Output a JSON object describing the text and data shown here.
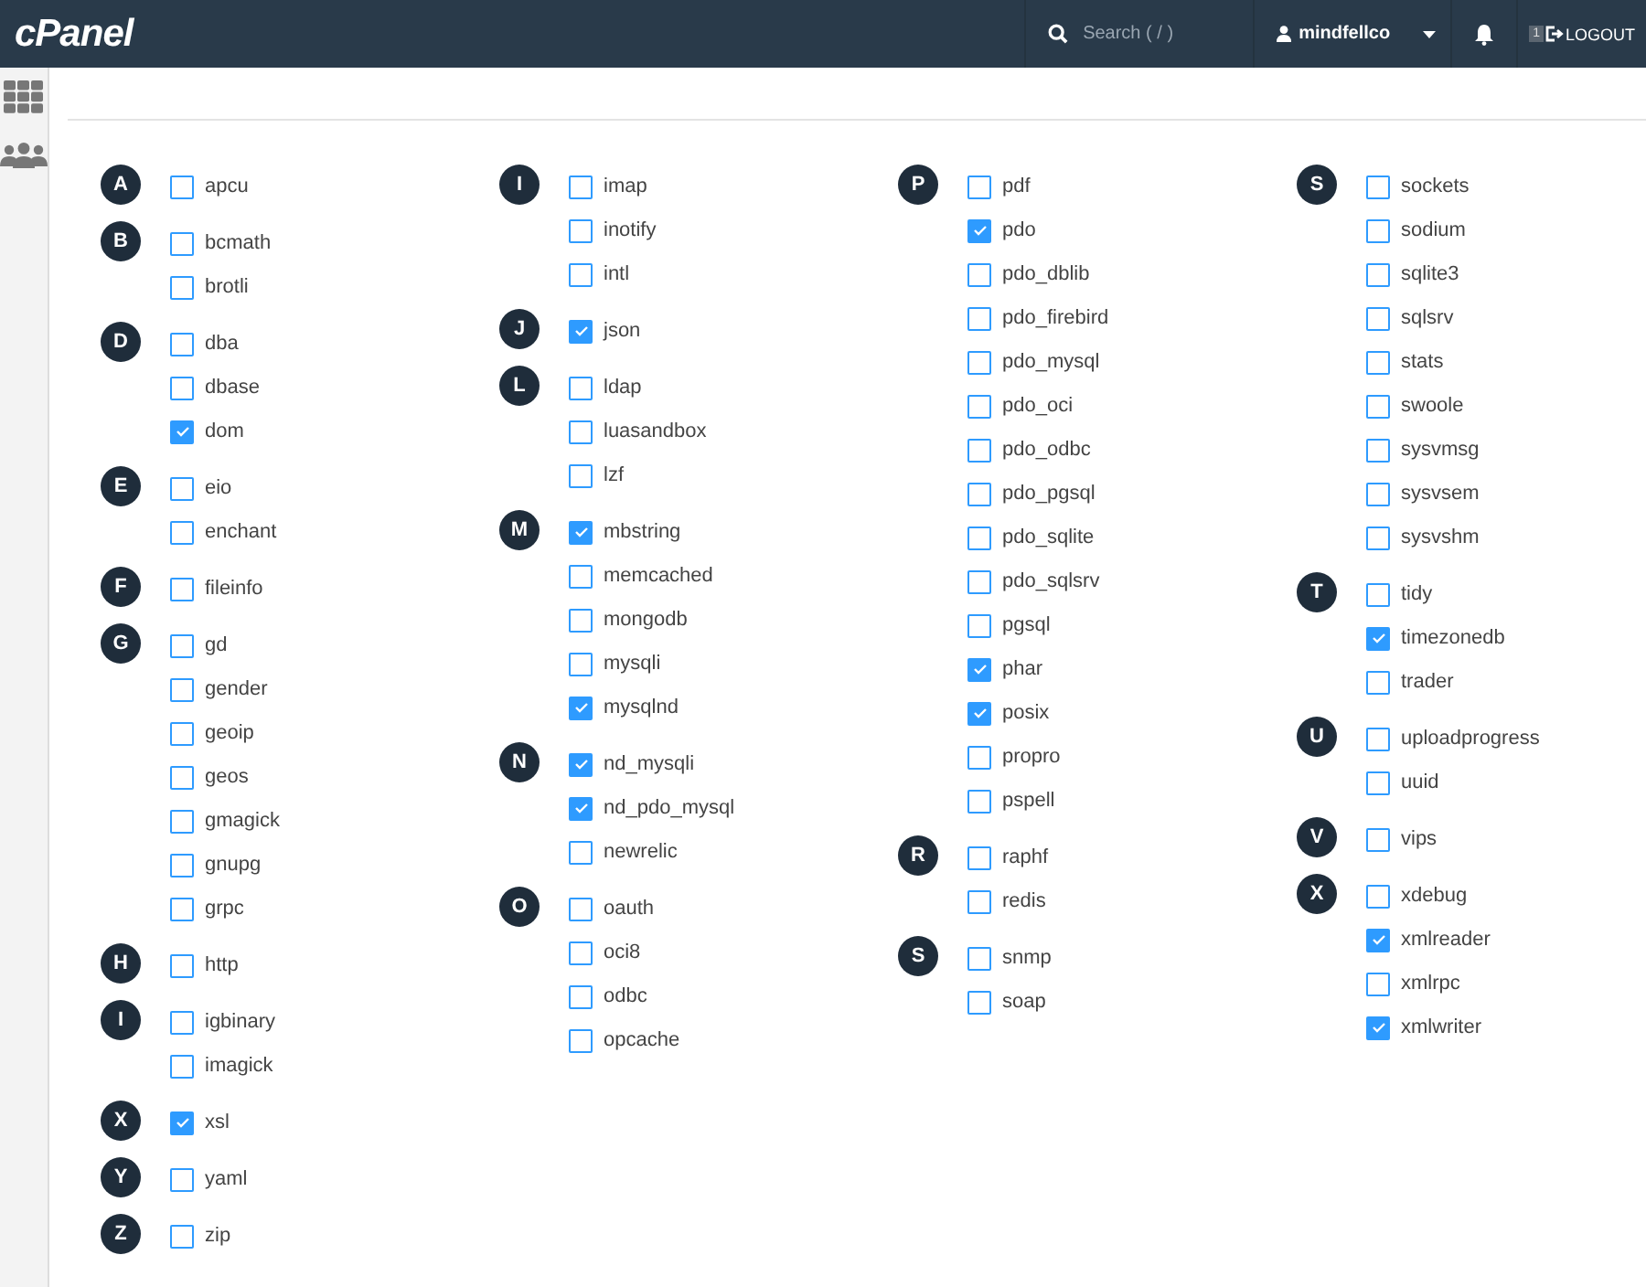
{
  "header": {
    "logo": "cPanel",
    "search": {
      "placeholder": "Search ( / )"
    },
    "user": "mindfellco",
    "notice_count": "1",
    "logout": "LOGOUT"
  },
  "columns": [
    [
      {
        "letter": "A",
        "items": [
          {
            "name": "apcu",
            "checked": false
          }
        ]
      },
      {
        "letter": "B",
        "items": [
          {
            "name": "bcmath",
            "checked": false
          },
          {
            "name": "brotli",
            "checked": false
          }
        ]
      },
      {
        "letter": "D",
        "items": [
          {
            "name": "dba",
            "checked": false
          },
          {
            "name": "dbase",
            "checked": false
          },
          {
            "name": "dom",
            "checked": true
          }
        ]
      },
      {
        "letter": "E",
        "items": [
          {
            "name": "eio",
            "checked": false
          },
          {
            "name": "enchant",
            "checked": false
          }
        ]
      },
      {
        "letter": "F",
        "items": [
          {
            "name": "fileinfo",
            "checked": false
          }
        ]
      },
      {
        "letter": "G",
        "items": [
          {
            "name": "gd",
            "checked": false
          },
          {
            "name": "gender",
            "checked": false
          },
          {
            "name": "geoip",
            "checked": false
          },
          {
            "name": "geos",
            "checked": false
          },
          {
            "name": "gmagick",
            "checked": false
          },
          {
            "name": "gnupg",
            "checked": false
          },
          {
            "name": "grpc",
            "checked": false
          }
        ]
      },
      {
        "letter": "H",
        "items": [
          {
            "name": "http",
            "checked": false
          }
        ]
      },
      {
        "letter": "I",
        "items": [
          {
            "name": "igbinary",
            "checked": false
          },
          {
            "name": "imagick",
            "checked": false
          }
        ]
      },
      {
        "letter": "X",
        "items": [
          {
            "name": "xsl",
            "checked": true
          }
        ]
      },
      {
        "letter": "Y",
        "items": [
          {
            "name": "yaml",
            "checked": false
          }
        ]
      },
      {
        "letter": "Z",
        "items": [
          {
            "name": "zip",
            "checked": false
          }
        ]
      }
    ],
    [
      {
        "letter": "I",
        "items": [
          {
            "name": "imap",
            "checked": false
          },
          {
            "name": "inotify",
            "checked": false
          },
          {
            "name": "intl",
            "checked": false
          }
        ]
      },
      {
        "letter": "J",
        "items": [
          {
            "name": "json",
            "checked": true
          }
        ]
      },
      {
        "letter": "L",
        "items": [
          {
            "name": "ldap",
            "checked": false
          },
          {
            "name": "luasandbox",
            "checked": false
          },
          {
            "name": "lzf",
            "checked": false
          }
        ]
      },
      {
        "letter": "M",
        "items": [
          {
            "name": "mbstring",
            "checked": true
          },
          {
            "name": "memcached",
            "checked": false
          },
          {
            "name": "mongodb",
            "checked": false
          },
          {
            "name": "mysqli",
            "checked": false
          },
          {
            "name": "mysqlnd",
            "checked": true
          }
        ]
      },
      {
        "letter": "N",
        "items": [
          {
            "name": "nd_mysqli",
            "checked": true
          },
          {
            "name": "nd_pdo_mysql",
            "checked": true
          },
          {
            "name": "newrelic",
            "checked": false
          }
        ]
      },
      {
        "letter": "O",
        "items": [
          {
            "name": "oauth",
            "checked": false
          },
          {
            "name": "oci8",
            "checked": false
          },
          {
            "name": "odbc",
            "checked": false
          },
          {
            "name": "opcache",
            "checked": false
          }
        ]
      }
    ],
    [
      {
        "letter": "P",
        "items": [
          {
            "name": "pdf",
            "checked": false
          },
          {
            "name": "pdo",
            "checked": true
          },
          {
            "name": "pdo_dblib",
            "checked": false
          },
          {
            "name": "pdo_firebird",
            "checked": false
          },
          {
            "name": "pdo_mysql",
            "checked": false
          },
          {
            "name": "pdo_oci",
            "checked": false
          },
          {
            "name": "pdo_odbc",
            "checked": false
          },
          {
            "name": "pdo_pgsql",
            "checked": false
          },
          {
            "name": "pdo_sqlite",
            "checked": false
          },
          {
            "name": "pdo_sqlsrv",
            "checked": false
          },
          {
            "name": "pgsql",
            "checked": false
          },
          {
            "name": "phar",
            "checked": true
          },
          {
            "name": "posix",
            "checked": true
          },
          {
            "name": "propro",
            "checked": false
          },
          {
            "name": "pspell",
            "checked": false
          }
        ]
      },
      {
        "letter": "R",
        "items": [
          {
            "name": "raphf",
            "checked": false
          },
          {
            "name": "redis",
            "checked": false
          }
        ]
      },
      {
        "letter": "S",
        "items": [
          {
            "name": "snmp",
            "checked": false
          },
          {
            "name": "soap",
            "checked": false
          }
        ]
      }
    ],
    [
      {
        "letter": "S",
        "items": [
          {
            "name": "sockets",
            "checked": false
          },
          {
            "name": "sodium",
            "checked": false
          },
          {
            "name": "sqlite3",
            "checked": false
          },
          {
            "name": "sqlsrv",
            "checked": false
          },
          {
            "name": "stats",
            "checked": false
          },
          {
            "name": "swoole",
            "checked": false
          },
          {
            "name": "sysvmsg",
            "checked": false
          },
          {
            "name": "sysvsem",
            "checked": false
          },
          {
            "name": "sysvshm",
            "checked": false
          }
        ]
      },
      {
        "letter": "T",
        "items": [
          {
            "name": "tidy",
            "checked": false
          },
          {
            "name": "timezonedb",
            "checked": true
          },
          {
            "name": "trader",
            "checked": false
          }
        ]
      },
      {
        "letter": "U",
        "items": [
          {
            "name": "uploadprogress",
            "checked": false
          },
          {
            "name": "uuid",
            "checked": false
          }
        ]
      },
      {
        "letter": "V",
        "items": [
          {
            "name": "vips",
            "checked": false
          }
        ]
      },
      {
        "letter": "X",
        "items": [
          {
            "name": "xdebug",
            "checked": false
          },
          {
            "name": "xmlreader",
            "checked": true
          },
          {
            "name": "xmlrpc",
            "checked": false
          },
          {
            "name": "xmlwriter",
            "checked": true
          }
        ]
      }
    ]
  ]
}
